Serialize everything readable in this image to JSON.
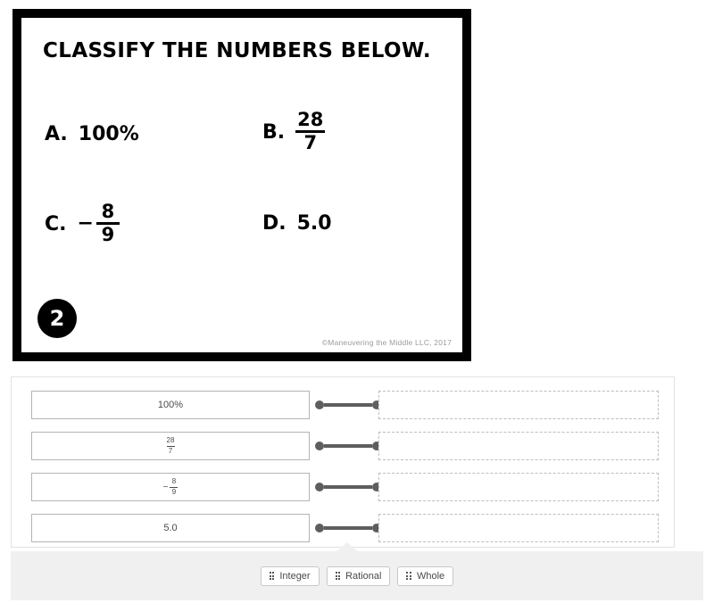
{
  "question_card": {
    "prompt": "CLASSIFY THE NUMBERS BELOW.",
    "badge_number": "2",
    "copyright": "©Maneuvering the Middle LLC, 2017",
    "choices": [
      {
        "label": "A.",
        "type": "text",
        "value": "100%"
      },
      {
        "label": "B.",
        "type": "fraction",
        "numerator": "28",
        "denominator": "7",
        "negative": false
      },
      {
        "label": "C.",
        "type": "fraction",
        "numerator": "8",
        "denominator": "9",
        "negative": true
      },
      {
        "label": "D.",
        "type": "text",
        "value": "5.0"
      }
    ]
  },
  "match_panel": {
    "rows": [
      {
        "value_type": "text",
        "value": "100%",
        "drop_zone_value": ""
      },
      {
        "value_type": "fraction",
        "numerator": "28",
        "denominator": "7",
        "negative": false,
        "drop_zone_value": ""
      },
      {
        "value_type": "fraction",
        "numerator": "8",
        "denominator": "9",
        "negative": true,
        "drop_zone_value": ""
      },
      {
        "value_type": "text",
        "value": "5.0",
        "drop_zone_value": ""
      }
    ]
  },
  "chip_tray": {
    "chips": [
      {
        "label": "Integer",
        "handle_icon": "drag-grip-icon"
      },
      {
        "label": "Rational",
        "handle_icon": "drag-grip-icon"
      },
      {
        "label": "Whole",
        "handle_icon": "drag-grip-icon"
      }
    ]
  },
  "colors": {
    "card_border": "#000000",
    "connector": "#5e5e5e",
    "tray_background": "#f0f0f0",
    "drop_zone_border": "#bdbdbd",
    "value_box_border": "#b4b4b4",
    "text": "#4a4a4a",
    "copyright_text": "#9b9b9b"
  }
}
